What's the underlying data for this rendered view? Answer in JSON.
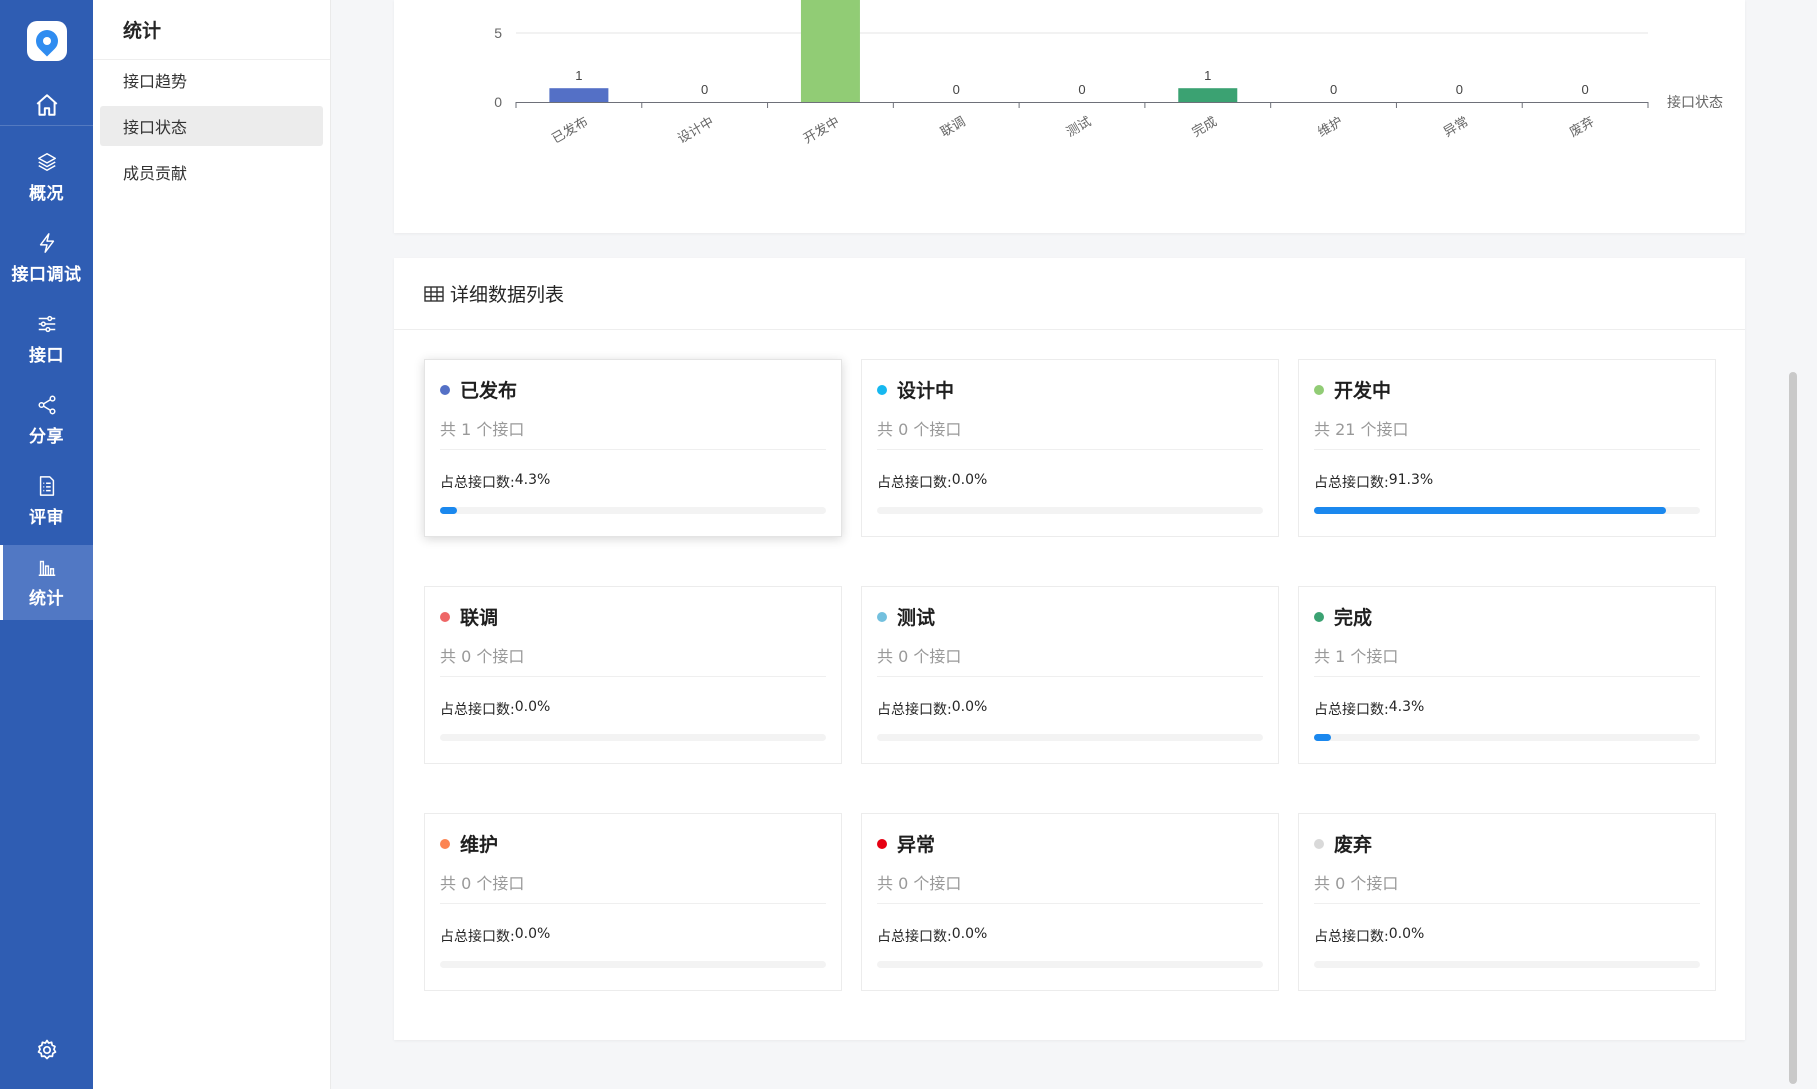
{
  "nav": {
    "items": [
      {
        "key": "overview",
        "label": "概况",
        "icon": "layers-icon"
      },
      {
        "key": "debug",
        "label": "接口调试",
        "icon": "lightning-icon"
      },
      {
        "key": "api",
        "label": "接口",
        "icon": "sliders-icon"
      },
      {
        "key": "share",
        "label": "分享",
        "icon": "share-icon"
      },
      {
        "key": "review",
        "label": "评审",
        "icon": "checklist-icon"
      },
      {
        "key": "stats",
        "label": "统计",
        "icon": "bar-chart-icon",
        "active": true
      }
    ]
  },
  "subnav": {
    "title": "统计",
    "items": [
      {
        "label": "接口趋势"
      },
      {
        "label": "接口状态",
        "active": true
      },
      {
        "label": "成员贡献"
      }
    ]
  },
  "chart_data": {
    "type": "bar",
    "categories": [
      "已发布",
      "设计中",
      "开发中",
      "联调",
      "测试",
      "完成",
      "维护",
      "异常",
      "废弃"
    ],
    "values": [
      1,
      0,
      21,
      0,
      0,
      1,
      0,
      0,
      0
    ],
    "data_labels": [
      "1",
      "0",
      "",
      "0",
      "0",
      "1",
      "0",
      "0",
      "0"
    ],
    "colors": [
      "#5470c6",
      "#16b8f0",
      "#91cc75",
      "#ee6666",
      "#73c0de",
      "#3ba272",
      "#fc8452",
      "#e60012",
      "#d9d9d9"
    ],
    "xlabel": "接口状态",
    "ylabel": "",
    "ytick_labels": [
      "0",
      "5"
    ],
    "grid": true
  },
  "list": {
    "title": "详细数据列表",
    "count_prefix": "共 ",
    "count_suffix": " 个接口",
    "pct_label": "占总接口数: ",
    "items": [
      {
        "name": "已发布",
        "count": "1",
        "pct": "4.3%",
        "fraction": 0.043,
        "color": "#5470c6"
      },
      {
        "name": "设计中",
        "count": "0",
        "pct": "0.0%",
        "fraction": 0,
        "color": "#16b8f0"
      },
      {
        "name": "开发中",
        "count": "21",
        "pct": "91.3%",
        "fraction": 0.913,
        "color": "#91cc75"
      },
      {
        "name": "联调",
        "count": "0",
        "pct": "0.0%",
        "fraction": 0,
        "color": "#ee6666"
      },
      {
        "name": "测试",
        "count": "0",
        "pct": "0.0%",
        "fraction": 0,
        "color": "#73c0de"
      },
      {
        "name": "完成",
        "count": "1",
        "pct": "4.3%",
        "fraction": 0.043,
        "color": "#3ba272"
      },
      {
        "name": "维护",
        "count": "0",
        "pct": "0.0%",
        "fraction": 0,
        "color": "#fc8452"
      },
      {
        "name": "异常",
        "count": "0",
        "pct": "0.0%",
        "fraction": 0,
        "color": "#e60012"
      },
      {
        "name": "废弃",
        "count": "0",
        "pct": "0.0%",
        "fraction": 0,
        "color": "#d9d9d9"
      }
    ]
  }
}
